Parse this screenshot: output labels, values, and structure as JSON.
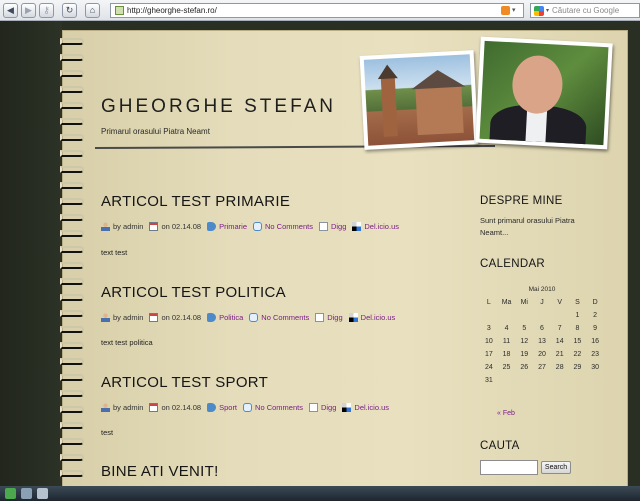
{
  "browser": {
    "url": "http://gheorghe-stefan.ro/",
    "search_placeholder": "Căutare cu Google"
  },
  "site": {
    "title": "GHEORGHE STEFAN",
    "tagline": "Primarul orasului Piatra Neamt"
  },
  "posts": [
    {
      "title": "ARTICOL TEST PRIMARIE",
      "author_prefix": "by",
      "author": "admin",
      "date_prefix": "on",
      "date": "02.14.08",
      "category": "Primarie",
      "comments": "No Comments",
      "digg": "Digg",
      "delicious": "Del.icio.us",
      "body": "text test"
    },
    {
      "title": "ARTICOL TEST POLITICA",
      "author_prefix": "by",
      "author": "admin",
      "date_prefix": "on",
      "date": "02.14.08",
      "category": "Politica",
      "comments": "No Comments",
      "digg": "Digg",
      "delicious": "Del.icio.us",
      "body": "text test politica"
    },
    {
      "title": "ARTICOL TEST SPORT",
      "author_prefix": "by",
      "author": "admin",
      "date_prefix": "on",
      "date": "02.14.08",
      "category": "Sport",
      "comments": "No Comments",
      "digg": "Digg",
      "delicious": "Del.icio.us",
      "body": "test"
    },
    {
      "title": "BINE ATI VENIT!"
    }
  ],
  "sidebar": {
    "about_title": "DESPRE MINE",
    "about_text": "Sunt primarul orasului Piatra Neamt...",
    "calendar_title": "CALENDAR",
    "search_title": "CAUTA",
    "search_button": "Search"
  },
  "calendar": {
    "caption": "Mai 2010",
    "weekdays": [
      "L",
      "Ma",
      "Mi",
      "J",
      "V",
      "S",
      "D"
    ],
    "cells": [
      "",
      "",
      "",
      "",
      "",
      "1",
      "2",
      "3",
      "4",
      "5",
      "6",
      "7",
      "8",
      "9",
      "10",
      "11",
      "12",
      "13",
      "14",
      "15",
      "16",
      "17",
      "18",
      "19",
      "20",
      "21",
      "22",
      "23",
      "24",
      "25",
      "26",
      "27",
      "28",
      "29",
      "30",
      "31",
      "",
      "",
      "",
      "",
      "",
      ""
    ],
    "prev": "« Feb"
  },
  "colors": {
    "link": "#7a1e86",
    "paper": "#e4dcba",
    "background": "#2a2f24"
  }
}
